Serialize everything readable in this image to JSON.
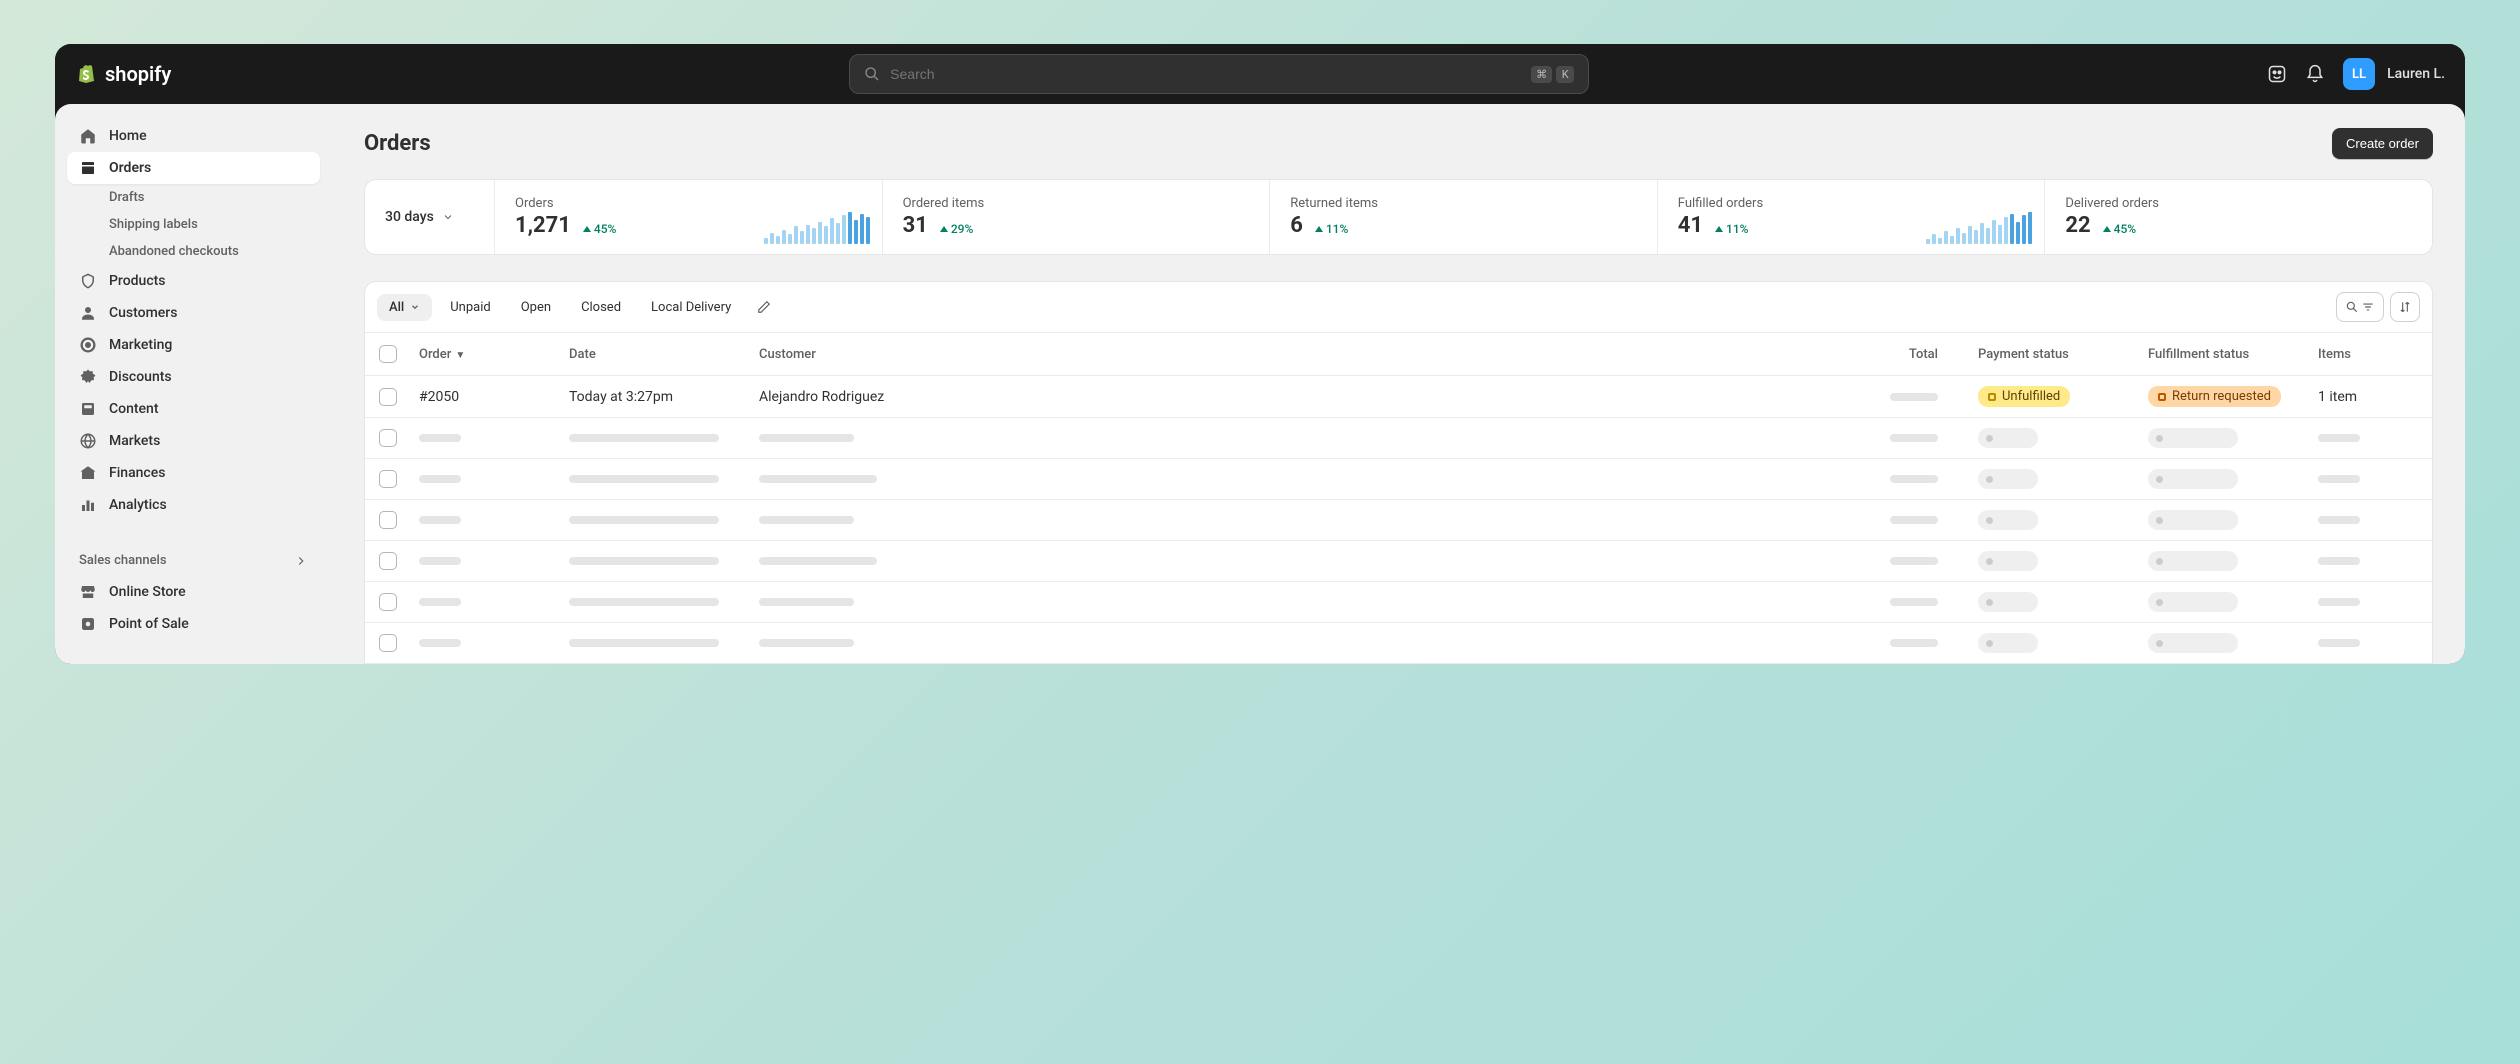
{
  "brand": "shopify",
  "search": {
    "placeholder": "Search",
    "kbd1": "⌘",
    "kbd2": "K"
  },
  "user": {
    "initials": "LL",
    "name": "Lauren L."
  },
  "sidebar": {
    "items": [
      {
        "label": "Home"
      },
      {
        "label": "Orders"
      },
      {
        "label": "Products"
      },
      {
        "label": "Customers"
      },
      {
        "label": "Marketing"
      },
      {
        "label": "Discounts"
      },
      {
        "label": "Content"
      },
      {
        "label": "Markets"
      },
      {
        "label": "Finances"
      },
      {
        "label": "Analytics"
      }
    ],
    "orders_sub": [
      {
        "label": "Drafts"
      },
      {
        "label": "Shipping labels"
      },
      {
        "label": "Abandoned checkouts"
      }
    ],
    "sales_channels_label": "Sales channels",
    "channels": [
      {
        "label": "Online Store"
      },
      {
        "label": "Point of Sale"
      }
    ]
  },
  "page": {
    "title": "Orders",
    "create_button": "Create order"
  },
  "stats": {
    "range": "30 days",
    "cards": [
      {
        "label": "Orders",
        "value": "1,271",
        "trend": "45%"
      },
      {
        "label": "Ordered items",
        "value": "31",
        "trend": "29%"
      },
      {
        "label": "Returned items",
        "value": "6",
        "trend": "11%"
      },
      {
        "label": "Fulfilled orders",
        "value": "41",
        "trend": "11%"
      },
      {
        "label": "Delivered orders",
        "value": "22",
        "trend": "45%"
      }
    ]
  },
  "tabs": [
    "All",
    "Unpaid",
    "Open",
    "Closed",
    "Local Delivery"
  ],
  "columns": {
    "order": "Order",
    "date": "Date",
    "total": "Total",
    "customer": "Customer",
    "payment": "Payment status",
    "fulfillment": "Fulfillment status",
    "items": "Items"
  },
  "row": {
    "order": "#2050",
    "date": "Today at 3:27pm",
    "customer": "Alejandro Rodriguez",
    "payment": "Unfulfilled",
    "fulfillment": "Return requested",
    "items": "1 item"
  }
}
